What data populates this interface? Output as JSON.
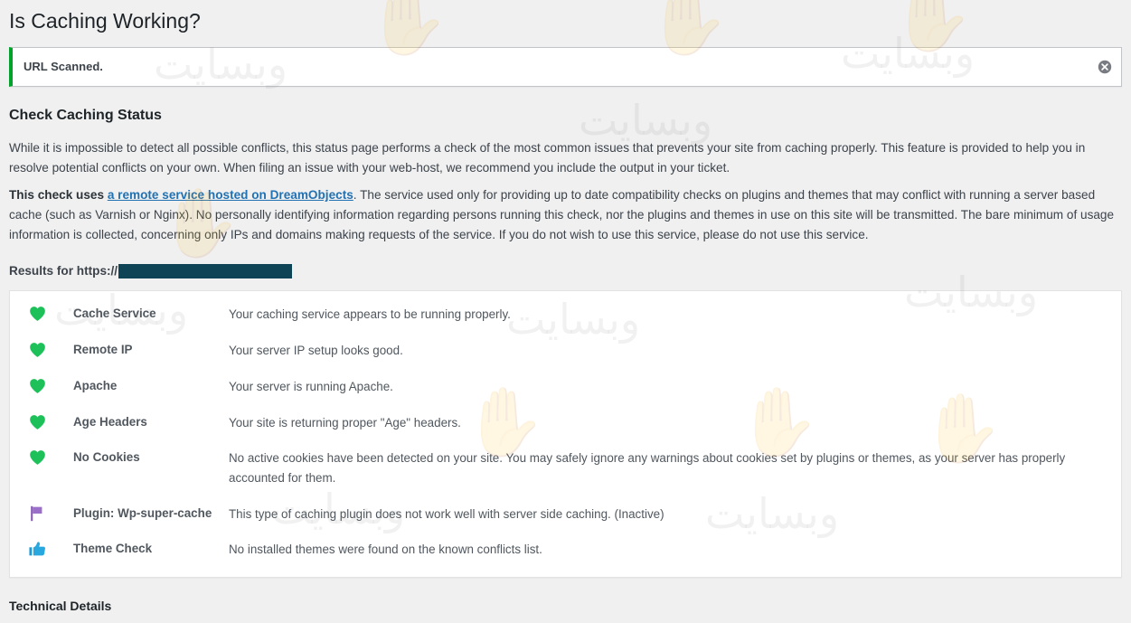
{
  "page": {
    "title": "Is Caching Working?"
  },
  "notice": {
    "message": "URL Scanned.",
    "dismiss_label": "Dismiss this notice.",
    "accent_color": "#00a32a"
  },
  "section": {
    "heading": "Check Caching Status",
    "paragraph_1": "While it is impossible to detect all possible conflicts, this status page performs a check of the most common issues that prevents your site from caching properly. This feature is provided to help you in resolve potential conflicts on your own. When filing an issue with your web-host, we recommend you include the output in your ticket.",
    "paragraph_2_bold": "This check uses ",
    "paragraph_2_link": "a remote service hosted on DreamObjects",
    "paragraph_2_rest": ". The service used only for providing up to date compatibility checks on plugins and themes that may conflict with running a server based cache (such as Varnish or Nginx). No personally identifying information regarding persons running this check, nor the plugins and themes in use on this site will be transmitted. The bare minimum of usage information is collected, concerning only IPs and domains making requests of the service. If you do not wish to use this service, please do not use this service.",
    "link_color": "#2271b1"
  },
  "results": {
    "label": "Results for https://",
    "redacted_url": "",
    "redaction_color": "#0f4356",
    "rows": [
      {
        "icon": "heart-icon",
        "icon_color": "#1ec05a",
        "label": "Cache Service",
        "description": "Your caching service appears to be running properly."
      },
      {
        "icon": "heart-icon",
        "icon_color": "#1ec05a",
        "label": "Remote IP",
        "description": "Your server IP setup looks good."
      },
      {
        "icon": "heart-icon",
        "icon_color": "#1ec05a",
        "label": "Apache",
        "description": "Your server is running Apache."
      },
      {
        "icon": "heart-icon",
        "icon_color": "#1ec05a",
        "label": "Age Headers",
        "description": "Your site is returning proper \"Age\" headers."
      },
      {
        "icon": "heart-icon",
        "icon_color": "#1ec05a",
        "label": "No Cookies",
        "description": "No active cookies have been detected on your site. You may safely ignore any warnings about cookies set by plugins or themes, as your server has properly accounted for them."
      },
      {
        "icon": "flag-icon",
        "icon_color": "#8a5fb8",
        "label": "Plugin: Wp-super-cache",
        "description": "This type of caching plugin does not work well with server side caching. (Inactive)"
      },
      {
        "icon": "thumbs-up-icon",
        "icon_color": "#1f9ad6",
        "label": "Theme Check",
        "description": "No installed themes were found on the known conflicts list."
      }
    ]
  },
  "footer": {
    "technical_details": "Technical Details"
  },
  "watermarks": {
    "hand_glyph": "✋",
    "text_glyph": "وبسایت"
  }
}
